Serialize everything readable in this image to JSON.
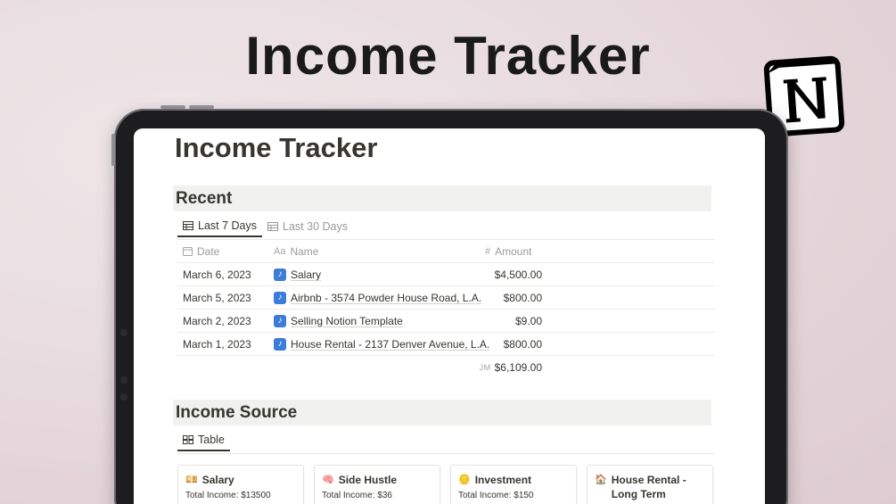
{
  "hero_title": "Income Tracker",
  "page": {
    "title": "Income Tracker",
    "recent": {
      "heading": "Recent",
      "tabs": [
        {
          "label": "Last 7 Days",
          "active": true,
          "icon": "table-icon"
        },
        {
          "label": "Last 30 Days",
          "active": false,
          "icon": "table-icon"
        }
      ],
      "columns": {
        "date": "Date",
        "name_prefix": "Aa",
        "name": "Name",
        "amount_prefix": "#",
        "amount": "Amount"
      },
      "rows": [
        {
          "date": "March 6, 2023",
          "name": "Salary",
          "amount": "$4,500.00"
        },
        {
          "date": "March 5, 2023",
          "name": "Airbnb - 3574 Powder House Road, L.A.",
          "amount": "$800.00"
        },
        {
          "date": "March 2, 2023",
          "name": "Selling Notion Template",
          "amount": "$9.00"
        },
        {
          "date": "March 1, 2023",
          "name": "House Rental - 2137 Denver Avenue, L.A.",
          "amount": "$800.00"
        }
      ],
      "sum_label": "JM",
      "sum_value": "$6,109.00"
    },
    "income_source": {
      "heading": "Income Source",
      "tab": "Table",
      "cards": [
        {
          "icon": "💴",
          "title": "Salary",
          "total": "Total Income: $13500"
        },
        {
          "icon": "🧠",
          "title": "Side Hustle",
          "total": "Total Income: $36"
        },
        {
          "icon": "🪙",
          "title": "Investment",
          "total": "Total Income: $150"
        },
        {
          "icon": "🏠",
          "title": "House Rental - Long Term",
          "total": ""
        }
      ]
    }
  },
  "colors": {
    "background": "#e9dde1",
    "text": "#37352f",
    "muted": "#9b9a97",
    "section_bar": "#f1f1ef",
    "page_icon": "#3b7dd8"
  }
}
